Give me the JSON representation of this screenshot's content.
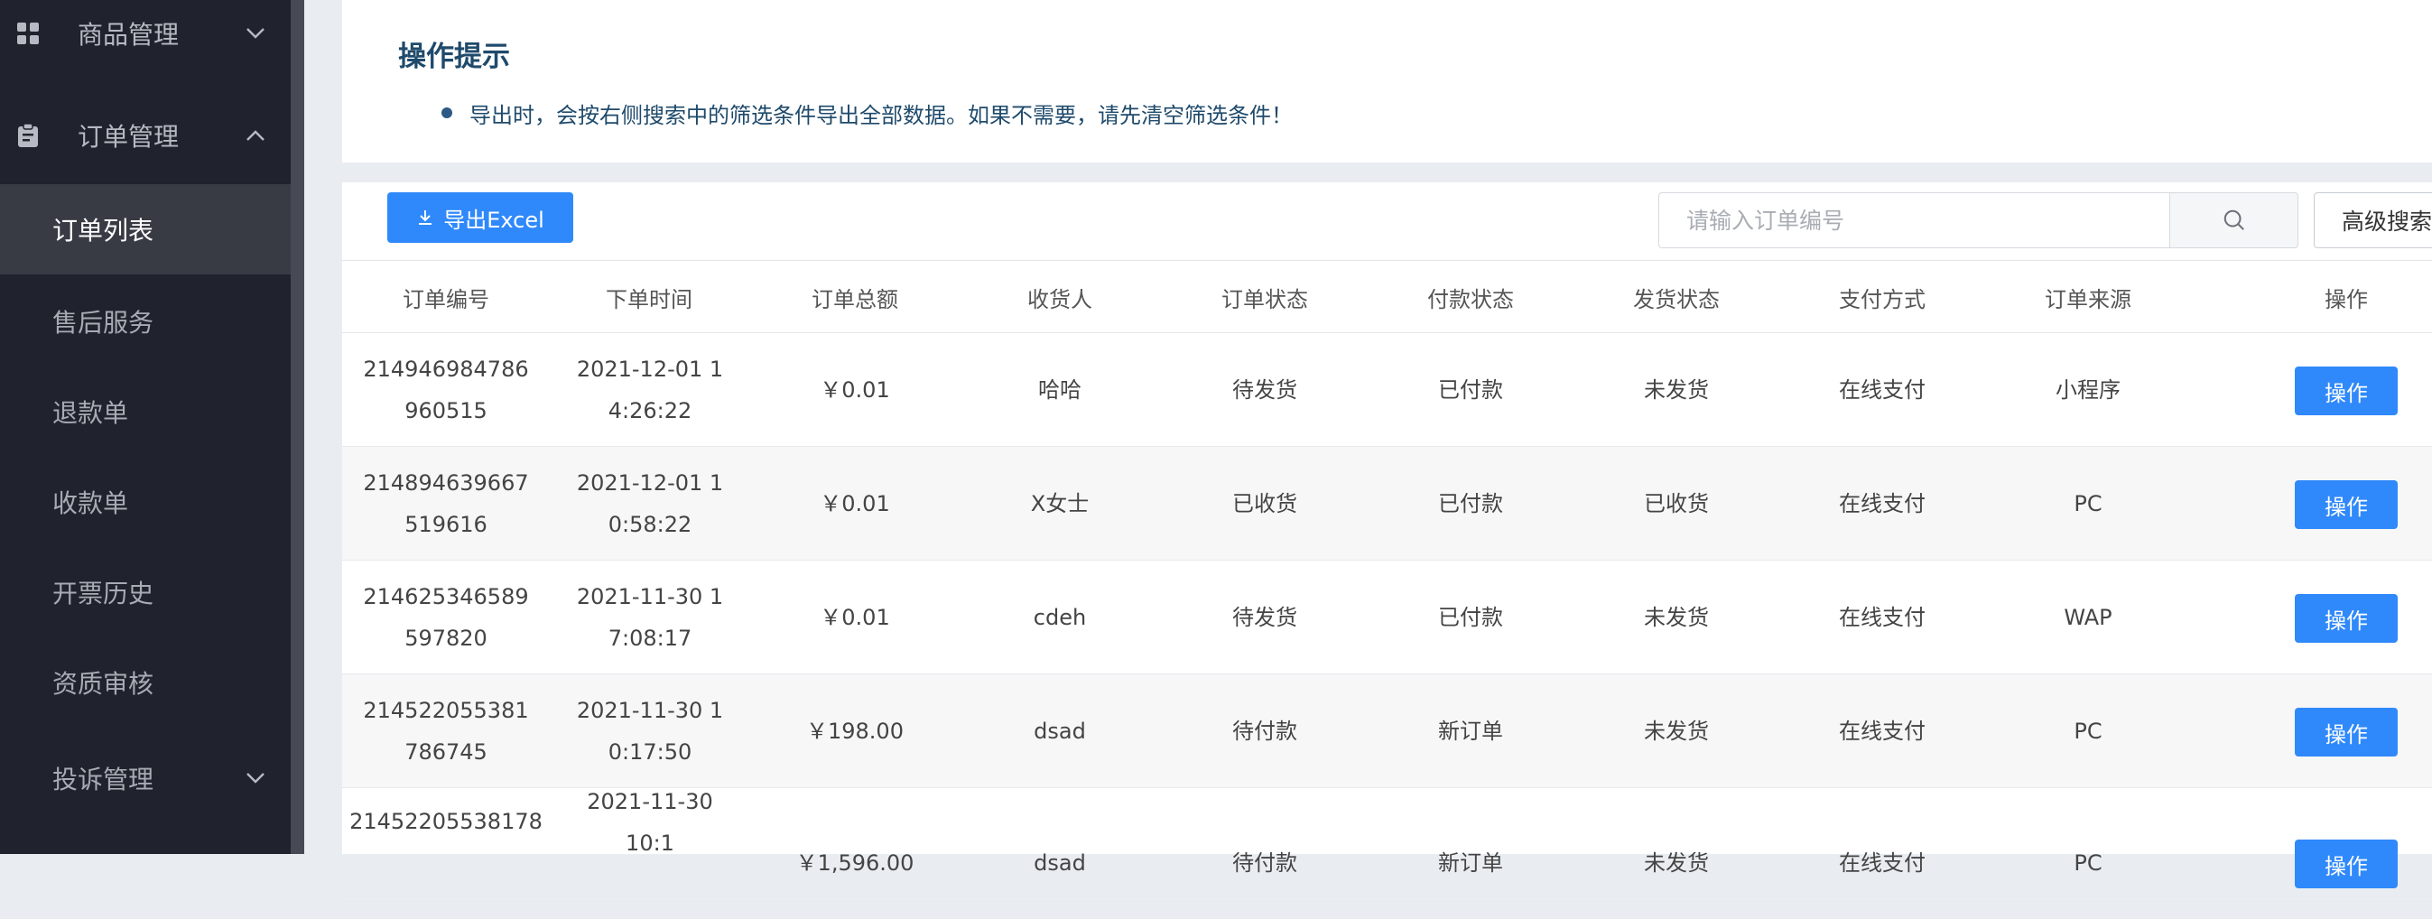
{
  "sidebar": {
    "groups": [
      {
        "label": "商品管理",
        "icon": "grid-icon",
        "expanded": false
      },
      {
        "label": "订单管理",
        "icon": "clipboard-icon",
        "expanded": true
      },
      {
        "label": "投诉管理",
        "expanded": false
      }
    ],
    "items": [
      {
        "label": "订单列表",
        "active": true
      },
      {
        "label": "售后服务"
      },
      {
        "label": "退款单"
      },
      {
        "label": "收款单"
      },
      {
        "label": "开票历史"
      },
      {
        "label": "资质审核"
      }
    ]
  },
  "tip": {
    "title": "操作提示",
    "text": "导出时，会按右侧搜索中的筛选条件导出全部数据。如果不需要，请先清空筛选条件！"
  },
  "toolbar": {
    "export_label": "导出Excel",
    "search_placeholder": "请输入订单编号",
    "advanced_search_label": "高级搜索"
  },
  "table": {
    "headers": [
      "订单编号",
      "下单时间",
      "订单总额",
      "收货人",
      "订单状态",
      "付款状态",
      "发货状态",
      "支付方式",
      "订单来源",
      "操作"
    ],
    "rows": [
      {
        "order_no": "214946984786960515",
        "time": "2021-12-01 14:26:22",
        "total": "￥0.01",
        "receiver": "哈哈",
        "order_status": "待发货",
        "pay_status": "已付款",
        "ship_status": "未发货",
        "pay_method": "在线支付",
        "source": "小程序",
        "action": "操作"
      },
      {
        "order_no": "214894639667519616",
        "time": "2021-12-01 10:58:22",
        "total": "￥0.01",
        "receiver": "X女士",
        "order_status": "已收货",
        "pay_status": "已付款",
        "ship_status": "已收货",
        "pay_method": "在线支付",
        "source": "PC",
        "action": "操作"
      },
      {
        "order_no": "214625346589597820",
        "time": "2021-11-30 17:08:17",
        "total": "￥0.01",
        "receiver": "cdeh",
        "order_status": "待发货",
        "pay_status": "已付款",
        "ship_status": "未发货",
        "pay_method": "在线支付",
        "source": "WAP",
        "action": "操作"
      },
      {
        "order_no": "214522055381786745",
        "time": "2021-11-30 10:17:50",
        "total": "￥198.00",
        "receiver": "dsad",
        "order_status": "待付款",
        "pay_status": "新订单",
        "ship_status": "未发货",
        "pay_method": "在线支付",
        "source": "PC",
        "action": "操作"
      },
      {
        "order_no": "21452205538178",
        "time": "2021-11-30 10:1",
        "total": "￥1,596.00",
        "receiver": "dsad",
        "order_status": "待付款",
        "pay_status": "新订单",
        "ship_status": "未发货",
        "pay_method": "在线支付",
        "source": "PC",
        "action": "操作"
      }
    ]
  }
}
